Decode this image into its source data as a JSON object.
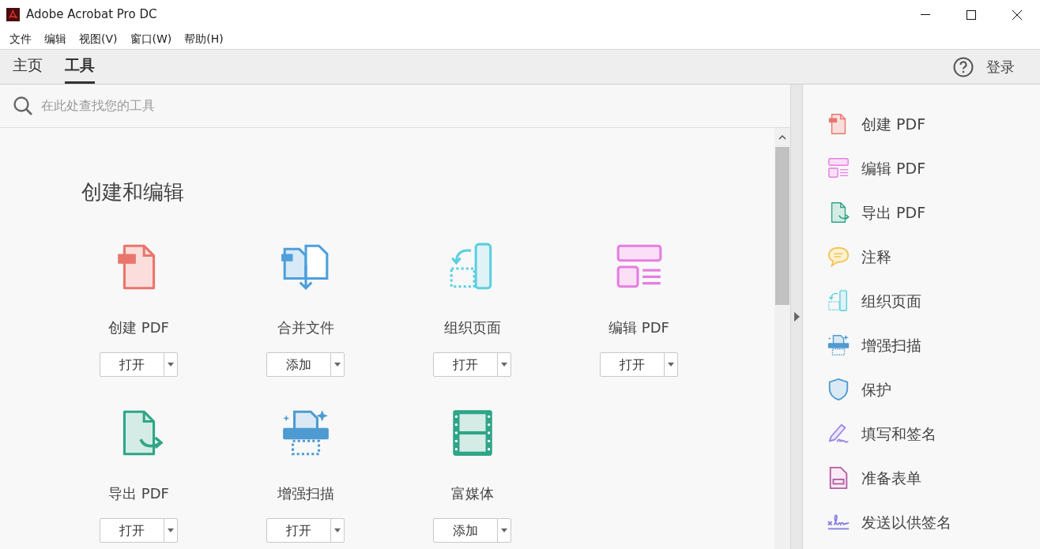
{
  "window": {
    "title": "Adobe Acrobat Pro DC"
  },
  "menu": [
    "文件",
    "编辑",
    "视图(V)",
    "窗口(W)",
    "帮助(H)"
  ],
  "tabs": [
    {
      "label": "主页",
      "selected": false
    },
    {
      "label": "工具",
      "selected": true
    }
  ],
  "sign_in": "登录",
  "search": {
    "placeholder": "在此处查找您的工具"
  },
  "section_title": "创建和编辑",
  "tools": [
    {
      "kind": "create",
      "name": "创建 PDF",
      "action": "打开"
    },
    {
      "kind": "combine",
      "name": "合并文件",
      "action": "添加"
    },
    {
      "kind": "organize",
      "name": "组织页面",
      "action": "打开"
    },
    {
      "kind": "edit",
      "name": "编辑 PDF",
      "action": "打开"
    },
    {
      "kind": "export",
      "name": "导出 PDF",
      "action": "打开"
    },
    {
      "kind": "scan",
      "name": "增强扫描",
      "action": "打开"
    },
    {
      "kind": "media",
      "name": "富媒体",
      "action": "添加"
    }
  ],
  "sidebar": {
    "items": [
      {
        "kind": "create",
        "label": "创建 PDF"
      },
      {
        "kind": "edit",
        "label": "编辑 PDF"
      },
      {
        "kind": "export",
        "label": "导出 PDF"
      },
      {
        "kind": "comment",
        "label": "注释"
      },
      {
        "kind": "organize",
        "label": "组织页面"
      },
      {
        "kind": "scan",
        "label": "增强扫描"
      },
      {
        "kind": "protect",
        "label": "保护"
      },
      {
        "kind": "fill-sign",
        "label": "填写和签名"
      },
      {
        "kind": "form",
        "label": "准备表单"
      },
      {
        "kind": "send-sign",
        "label": "发送以供签名"
      }
    ]
  }
}
